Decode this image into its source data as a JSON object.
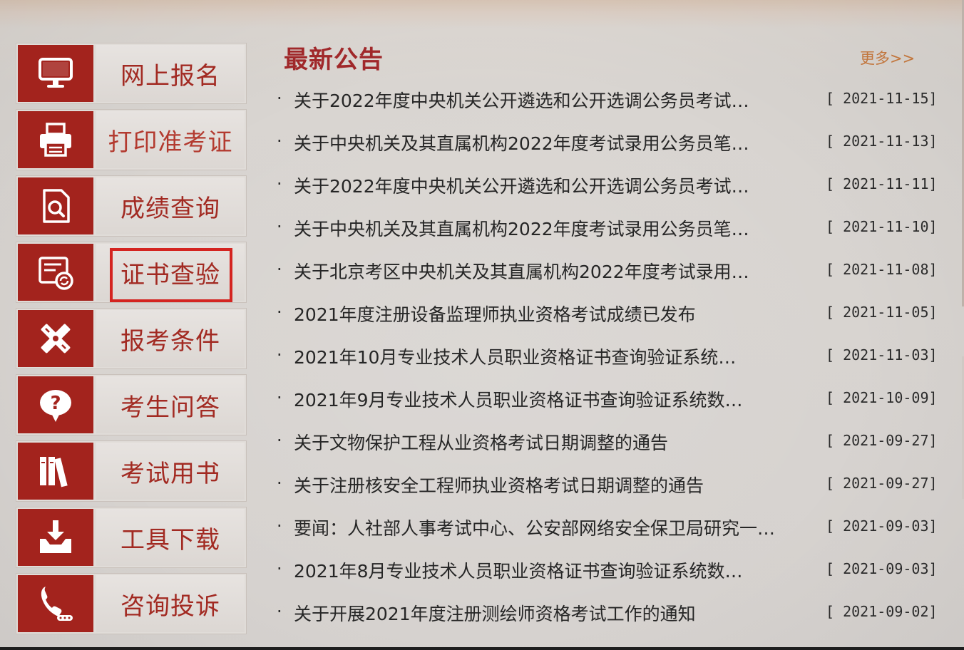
{
  "menu": {
    "items": [
      {
        "label": "网上报名",
        "icon": "monitor-icon"
      },
      {
        "label": "打印准考证",
        "icon": "printer-icon"
      },
      {
        "label": "成绩查询",
        "icon": "document-search-icon"
      },
      {
        "label": "证书查验",
        "icon": "certificate-verify-icon"
      },
      {
        "label": "报考条件",
        "icon": "pencil-ruler-icon"
      },
      {
        "label": "考生问答",
        "icon": "question-bubble-icon"
      },
      {
        "label": "考试用书",
        "icon": "books-icon"
      },
      {
        "label": "工具下载",
        "icon": "download-tray-icon"
      },
      {
        "label": "咨询投诉",
        "icon": "telephone-icon"
      }
    ],
    "highlighted_index": 3
  },
  "news": {
    "title": "最新公告",
    "more_label": "更多>>",
    "items": [
      {
        "title": "关于2022年度中央机关公开遴选和公开选调公务员考试…",
        "date": "[ 2021-11-15]"
      },
      {
        "title": "关于中央机关及其直属机构2022年度考试录用公务员笔…",
        "date": "[ 2021-11-13]"
      },
      {
        "title": "关于2022年度中央机关公开遴选和公开选调公务员考试…",
        "date": "[ 2021-11-11]"
      },
      {
        "title": "关于中央机关及其直属机构2022年度考试录用公务员笔…",
        "date": "[ 2021-11-10]"
      },
      {
        "title": "关于北京考区中央机关及其直属机构2022年度考试录用…",
        "date": "[ 2021-11-08]"
      },
      {
        "title": "2021年度注册设备监理师执业资格考试成绩已发布",
        "date": "[ 2021-11-05]"
      },
      {
        "title": "2021年10月专业技术人员职业资格证书查询验证系统…",
        "date": "[ 2021-11-03]"
      },
      {
        "title": "2021年9月专业技术人员职业资格证书查询验证系统数…",
        "date": "[ 2021-10-09]"
      },
      {
        "title": "关于文物保护工程从业资格考试日期调整的通告",
        "date": "[ 2021-09-27]"
      },
      {
        "title": "关于注册核安全工程师执业资格考试日期调整的通告",
        "date": "[ 2021-09-27]"
      },
      {
        "title": "要闻：人社部人事考试中心、公安部网络安全保卫局研究一…",
        "date": "[ 2021-09-03]"
      },
      {
        "title": "2021年8月专业技术人员职业资格证书查询验证系统数…",
        "date": "[ 2021-09-03]"
      },
      {
        "title": "关于开展2021年度注册测绘师资格考试工作的通知",
        "date": "[ 2021-09-02]"
      }
    ]
  },
  "colors": {
    "accent_red": "#a3231d",
    "highlight_border": "#d42420",
    "title_red": "#a0282a",
    "more_orange": "#c2763d"
  }
}
